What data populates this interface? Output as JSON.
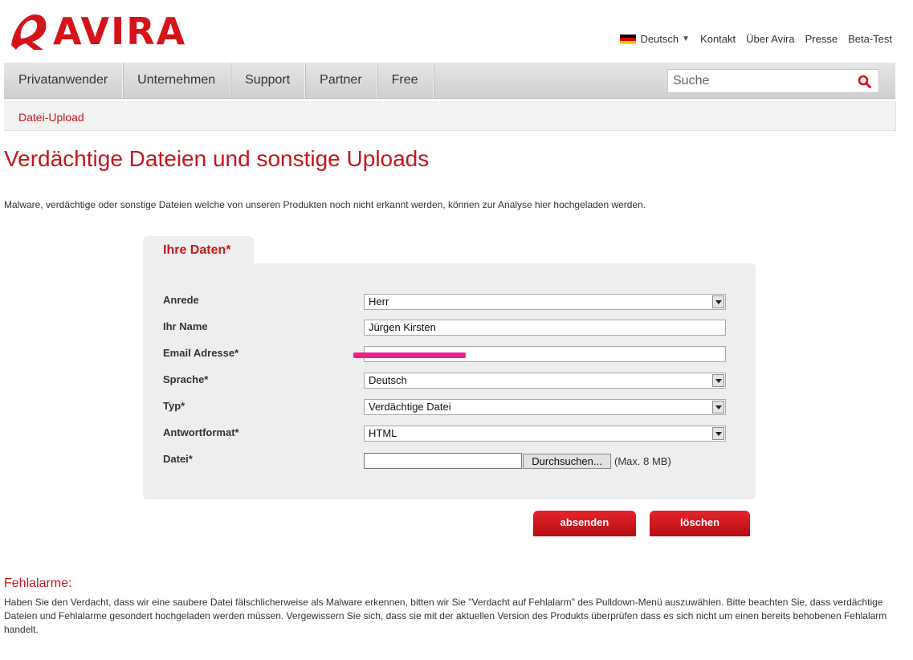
{
  "brand": {
    "name": "AVIRA",
    "color": "#d5131a",
    "logo_icon": "avira-umbrella-logo"
  },
  "top_links": {
    "language": "Deutsch",
    "items": [
      "Kontakt",
      "Über Avira",
      "Presse",
      "Beta-Test"
    ]
  },
  "nav": {
    "items": [
      "Privatanwender",
      "Unternehmen",
      "Support",
      "Partner",
      "Free"
    ],
    "search_placeholder": "Suche"
  },
  "breadcrumb": "Datei-Upload",
  "page": {
    "title": "Verdächtige Dateien und sonstige Uploads",
    "intro": "Malware, verdächtige oder sonstige Dateien welche von unseren Produkten noch nicht erkannt werden, können zur Analyse hier hochgeladen werden."
  },
  "form": {
    "tab": "Ihre Daten*",
    "fields": [
      {
        "label": "Anrede",
        "value": "Herr",
        "type": "select"
      },
      {
        "label": "Ihr Name",
        "value": "Jürgen Kirsten",
        "type": "text"
      },
      {
        "label": "Email Adresse*",
        "value": "",
        "type": "text"
      },
      {
        "label": "Sprache*",
        "value": "Deutsch",
        "type": "select"
      },
      {
        "label": "Typ*",
        "value": "Verdächtige Datei",
        "type": "select"
      },
      {
        "label": "Antwortformat*",
        "value": "HTML",
        "type": "select"
      },
      {
        "label": "Datei*",
        "value": "",
        "type": "file"
      }
    ],
    "browse_label": "Durchsuchen...",
    "file_limit": "(Max. 8 MB)",
    "submit_label": "absenden",
    "clear_label": "löschen"
  },
  "false_alarms": {
    "title": "Fehlalarme:",
    "text": "Haben Sie den Verdacht, dass wir eine saubere Datei fälschlicherweise als Malware erkennen, bitten wir Sie \"Verdacht auf Fehlalarm\" des Pulldown-Menü auszuwählen. Bitte beachten Sie, dass verdächtige Dateien und Fehlalarme gesondert hochgeladen werden müssen. Vergewissern Sie sich, dass sie mit der aktuellen Version des Produkts überprüfen dass es sich nicht um einen bereits behobenen Fehlalarm handelt."
  },
  "colors": {
    "accent": "#c4161c",
    "button_red": "#d41a20",
    "panel": "#eeeeee",
    "redaction": "#ec1f8d"
  }
}
